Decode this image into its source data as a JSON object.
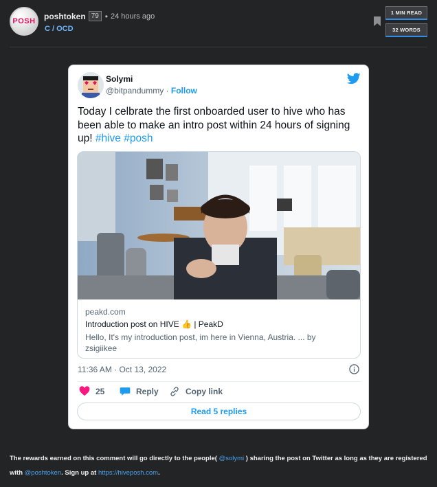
{
  "post": {
    "avatar_text": "POSH",
    "author": "poshtoken",
    "reputation": "79",
    "separator": "•",
    "time": "24 hours ago",
    "community": "C / OCD",
    "badges": {
      "read_time": "1 MIN READ",
      "words": "32 WORDS"
    }
  },
  "tweet": {
    "name": "Solymi",
    "handle": "@bitpandummy",
    "handle_sep": " · ",
    "follow": "Follow",
    "text_plain": "Today I celbrate the first onboarded user to hive who has been able to make an intro post within 24 hours of signing up! ",
    "hashtag1": "#hive",
    "hashtag2": "#posh",
    "link": {
      "domain": "peakd.com",
      "title": "Introduction post on HIVE 👍 | PeakD",
      "description": "Hello, It's my introduction post, im here in Vienna, Austria. ... by zsigiikee"
    },
    "timestamp": "11:36 AM · Oct 13, 2022",
    "likes": "25",
    "reply_label": "Reply",
    "copy_label": "Copy link",
    "read_replies": "Read 5 replies"
  },
  "footer": {
    "text1": "The rewards earned on this comment will go directly to the people( ",
    "mention1": "@solymi",
    "text2": " ) sharing the post on Twitter as long as they are registered with ",
    "mention2": "@poshtoken",
    "text3": ". Sign up at ",
    "url": "https://hiveposh.com",
    "text4": "."
  },
  "colors": {
    "background": "#232426",
    "link_blue": "#4aa3f0",
    "twitter_blue": "#1d9bf0",
    "like_pink": "#f91880"
  },
  "icons": [
    "bookmark-icon",
    "twitter-bird-icon",
    "info-icon",
    "heart-icon",
    "reply-bubble-icon",
    "link-icon"
  ]
}
